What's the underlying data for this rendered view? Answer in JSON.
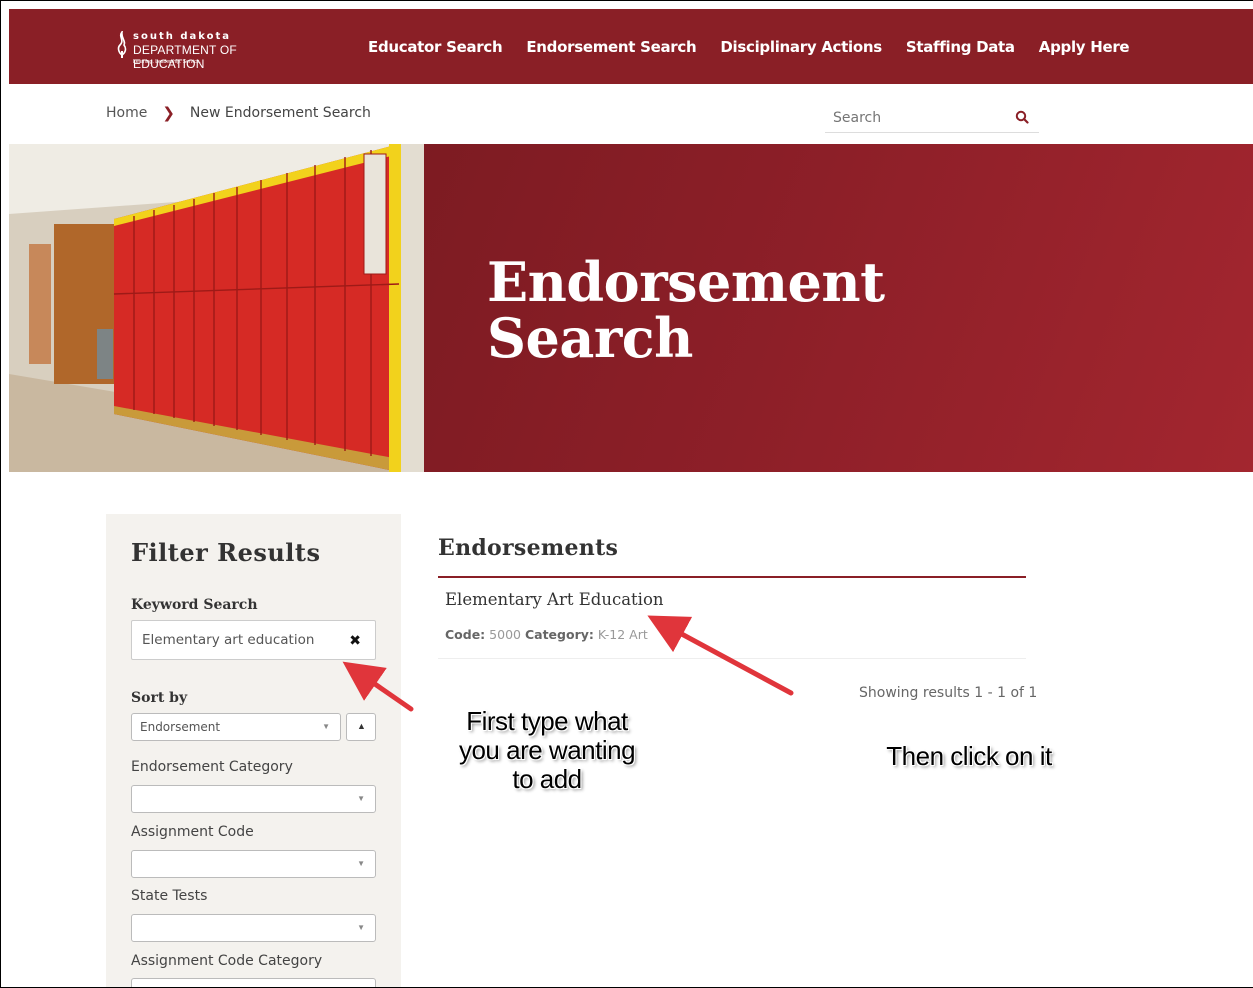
{
  "header": {
    "logo": {
      "line1": "south dakota",
      "line2": "DEPARTMENT OF EDUCATION",
      "tagline": "Learning. Leadership. Service."
    },
    "nav": [
      "Educator Search",
      "Endorsement Search",
      "Disciplinary Actions",
      "Staffing Data",
      "Apply Here"
    ]
  },
  "breadcrumb": {
    "home": "Home",
    "current": "New Endorsement Search"
  },
  "search": {
    "placeholder": "Search"
  },
  "hero": {
    "title_line1": "Endorsement",
    "title_line2": "Search"
  },
  "filter": {
    "title": "Filter Results",
    "keyword_label": "Keyword Search",
    "keyword_value": "Elementary art education",
    "sort_label": "Sort by",
    "sort_value": "Endorsement",
    "category_label": "Endorsement Category",
    "assignment_code_label": "Assignment Code",
    "state_tests_label": "State Tests",
    "assignment_code_category_label": "Assignment Code Category"
  },
  "results": {
    "title": "Endorsements",
    "items": [
      {
        "name": "Elementary Art Education",
        "code_label": "Code:",
        "code": "5000",
        "category_label": "Category:",
        "category": "K-12 Art"
      }
    ],
    "showing": "Showing results 1 - 1 of 1"
  },
  "annotations": {
    "note1_line1": "First type what",
    "note1_line2": "you are wanting",
    "note1_line3": "to add",
    "note2": "Then click on it"
  },
  "colors": {
    "brand": "#8a1f26",
    "arrow": "#e0353b"
  }
}
